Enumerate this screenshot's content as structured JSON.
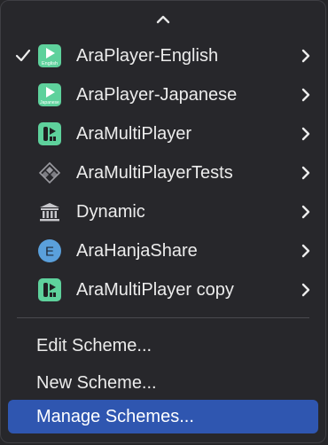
{
  "menu": {
    "scroll_icon": "chevron-up-icon",
    "schemes": [
      {
        "label": "AraPlayer-English",
        "checked": true,
        "icon": "app-target-icon",
        "icon_caption": "English"
      },
      {
        "label": "AraPlayer-Japanese",
        "checked": false,
        "icon": "app-target-icon",
        "icon_caption": "Japanese"
      },
      {
        "label": "AraMultiPlayer",
        "checked": false,
        "icon": "multiplayer-app-icon"
      },
      {
        "label": "AraMultiPlayerTests",
        "checked": false,
        "icon": "test-bundle-icon"
      },
      {
        "label": "Dynamic",
        "checked": false,
        "icon": "framework-icon"
      },
      {
        "label": "AraHanjaShare",
        "checked": false,
        "icon": "extension-icon",
        "icon_letter": "E"
      },
      {
        "label": "AraMultiPlayer copy",
        "checked": false,
        "icon": "multiplayer-app-icon"
      }
    ],
    "actions": [
      {
        "label": "Edit Scheme..."
      },
      {
        "label": "New Scheme..."
      },
      {
        "label": "Manage Schemes...",
        "highlighted": true
      }
    ]
  },
  "colors": {
    "background": "#27272b",
    "text": "#ececec",
    "highlight": "#2f56b0",
    "app_icon_green": "#5ed19c",
    "extension_blue": "#5aa0dc"
  }
}
